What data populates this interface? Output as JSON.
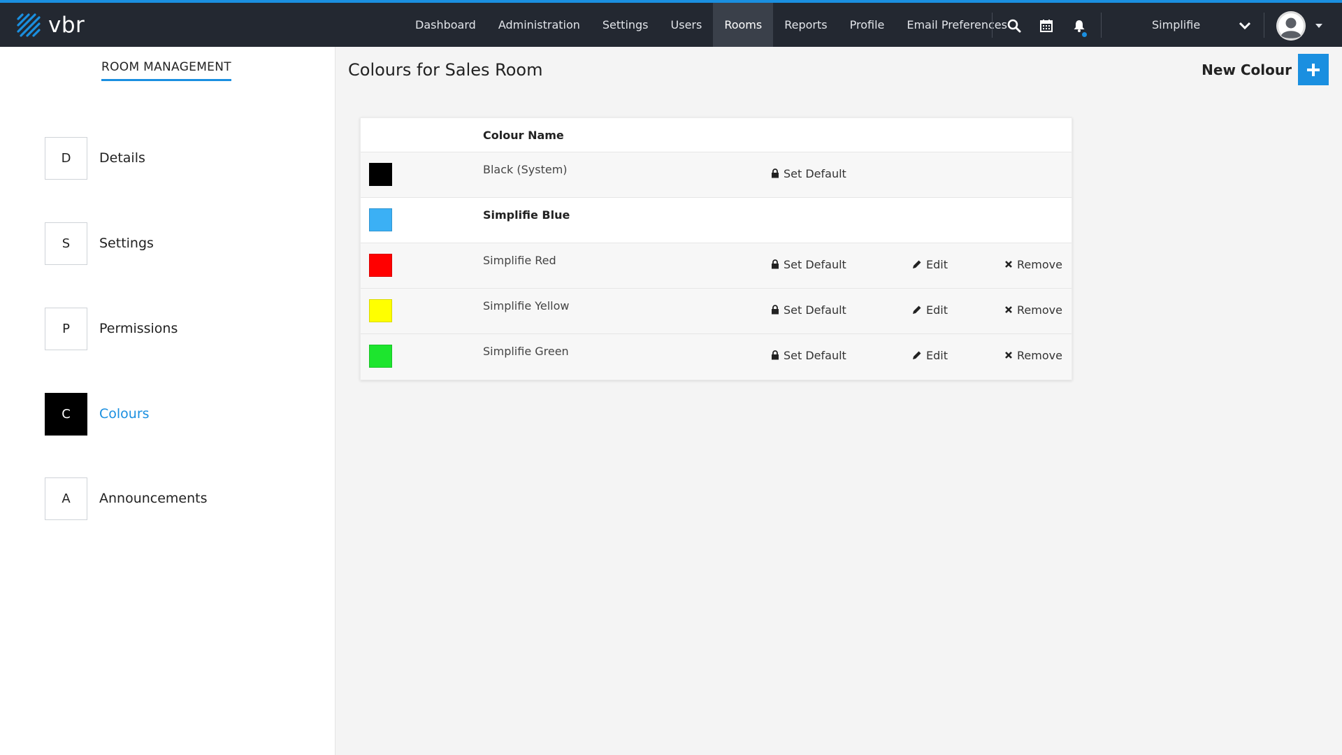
{
  "brand": {
    "name": "vbr"
  },
  "nav": {
    "items": [
      {
        "label": "Dashboard",
        "active": false
      },
      {
        "label": "Administration",
        "active": false
      },
      {
        "label": "Settings",
        "active": false
      },
      {
        "label": "Users",
        "active": false
      },
      {
        "label": "Rooms",
        "active": true
      },
      {
        "label": "Reports",
        "active": false
      },
      {
        "label": "Profile",
        "active": false
      },
      {
        "label": "Email Preferences",
        "active": false
      }
    ],
    "icons": [
      "search-icon",
      "calendar-icon",
      "bell-icon"
    ],
    "org_name": "Simplifie"
  },
  "sidebar": {
    "title": "ROOM MANAGEMENT",
    "items": [
      {
        "letter": "D",
        "label": "Details",
        "active": false
      },
      {
        "letter": "S",
        "label": "Settings",
        "active": false
      },
      {
        "letter": "P",
        "label": "Permissions",
        "active": false
      },
      {
        "letter": "C",
        "label": "Colours",
        "active": true
      },
      {
        "letter": "A",
        "label": "Announcements",
        "active": false
      }
    ]
  },
  "main": {
    "title": "Colours for Sales Room",
    "new_colour_label": "New Colour",
    "table": {
      "column_header": "Colour Name",
      "actions": {
        "set_default": "Set Default",
        "edit": "Edit",
        "remove": "Remove"
      },
      "rows": [
        {
          "name": "Black (System)",
          "color": "#000000",
          "bold": false,
          "set_default": true,
          "edit": false,
          "remove": false
        },
        {
          "name": "Simplifie Blue",
          "color": "#3bb0f5",
          "bold": true,
          "set_default": false,
          "edit": false,
          "remove": false
        },
        {
          "name": "Simplifie Red",
          "color": "#ff0000",
          "bold": false,
          "set_default": true,
          "edit": true,
          "remove": true
        },
        {
          "name": "Simplifie Yellow",
          "color": "#ffff00",
          "bold": false,
          "set_default": true,
          "edit": true,
          "remove": true
        },
        {
          "name": "Simplifie Green",
          "color": "#1de52e",
          "bold": false,
          "set_default": true,
          "edit": true,
          "remove": true
        }
      ]
    }
  },
  "colors": {
    "accent": "#1a8fe0",
    "topbar": "#232831",
    "active_nav": "#3a404a"
  }
}
